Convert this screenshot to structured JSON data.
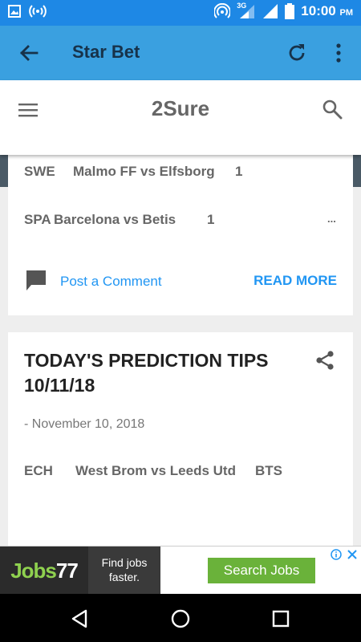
{
  "status_bar": {
    "time": "10:00",
    "ampm": "PM",
    "network": "3G",
    "icons": [
      "image-icon",
      "broadcast-icon",
      "hotspot-icon",
      "signal-icon",
      "battery-icon"
    ]
  },
  "app_bar": {
    "title": "Star Bet",
    "icons": [
      "back-arrow-icon",
      "refresh-icon",
      "more-vert-icon"
    ]
  },
  "site_header": {
    "brand": "2Sure",
    "icons": [
      "menu-icon",
      "search-icon"
    ]
  },
  "post1": {
    "rows": [
      {
        "league": "SWE",
        "match": "Malmo FF vs Elfsborg",
        "tip": "1"
      },
      {
        "league": "SPA",
        "match": "Barcelona vs Betis",
        "tip": "1",
        "extra": "..."
      }
    ],
    "post_comment": "Post a Comment",
    "read_more": "READ MORE"
  },
  "post2": {
    "title": "TODAY'S PREDICTION TIPS 10/11/18",
    "date": "- November 10, 2018",
    "rows": [
      {
        "league": "ECH",
        "match": "West Brom vs Leeds Utd",
        "tip": "BTS"
      }
    ]
  },
  "ad": {
    "logo_part1": "Jobs",
    "logo_part2": "77",
    "tagline_line1": "Find jobs",
    "tagline_line2": "faster.",
    "cta": "Search Jobs",
    "colors": {
      "cta": "#6ab23a",
      "logo": "#8fd14f"
    }
  },
  "colors": {
    "status_bar": "#1e88e5",
    "app_bar": "#3aa0e0",
    "link": "#2196f3"
  }
}
